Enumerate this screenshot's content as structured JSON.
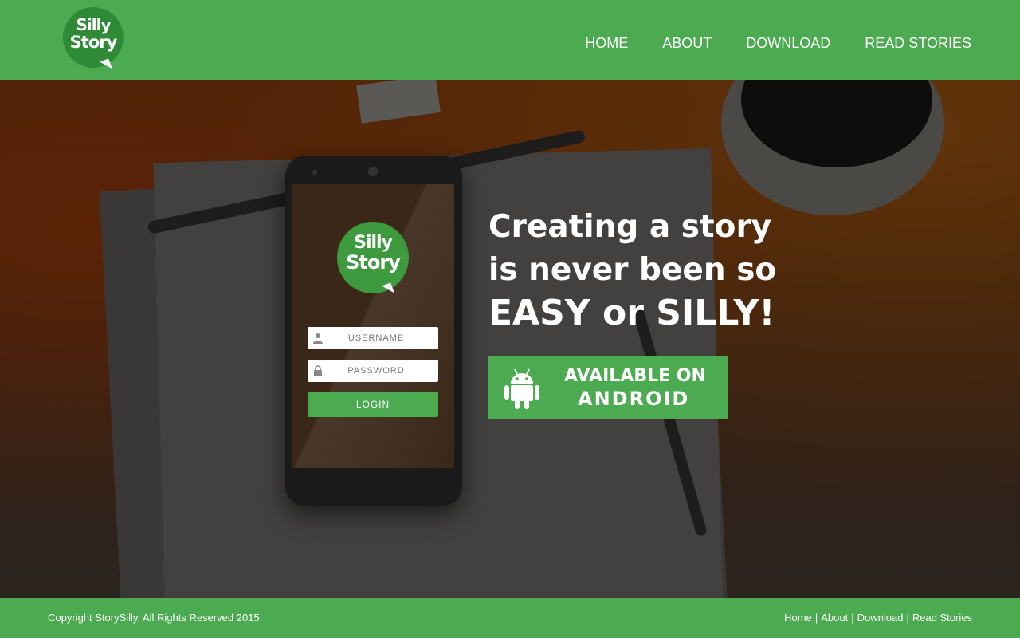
{
  "header": {
    "logo": {
      "line1": "Silly",
      "line2": "Story"
    },
    "nav": [
      {
        "label": "HOME"
      },
      {
        "label": "ABOUT"
      },
      {
        "label": "DOWNLOAD"
      },
      {
        "label": "READ STORIES"
      }
    ]
  },
  "hero": {
    "phone": {
      "logo": {
        "line1": "Silly",
        "line2": "Story"
      },
      "username_placeholder": "USERNAME",
      "password_placeholder": "PASSWORD",
      "login_label": "LOGIN"
    },
    "tagline": {
      "line1": "Creating a story",
      "line2": "is never been so",
      "line3": "EASY or SILLY!"
    },
    "android_button": {
      "line1": "AVAILABLE ON",
      "line2": "ANDROID",
      "icon": "android-icon"
    }
  },
  "footer": {
    "copyright": "Copyright StorySilly.  All Rights Reserved 2015.",
    "links": [
      {
        "label": "Home"
      },
      {
        "label": "About"
      },
      {
        "label": "Download"
      },
      {
        "label": "Read Stories"
      }
    ],
    "separator": "|"
  },
  "colors": {
    "brand_green": "#4caa50",
    "logo_green": "#2f8a36",
    "text_white": "#ffffff"
  }
}
